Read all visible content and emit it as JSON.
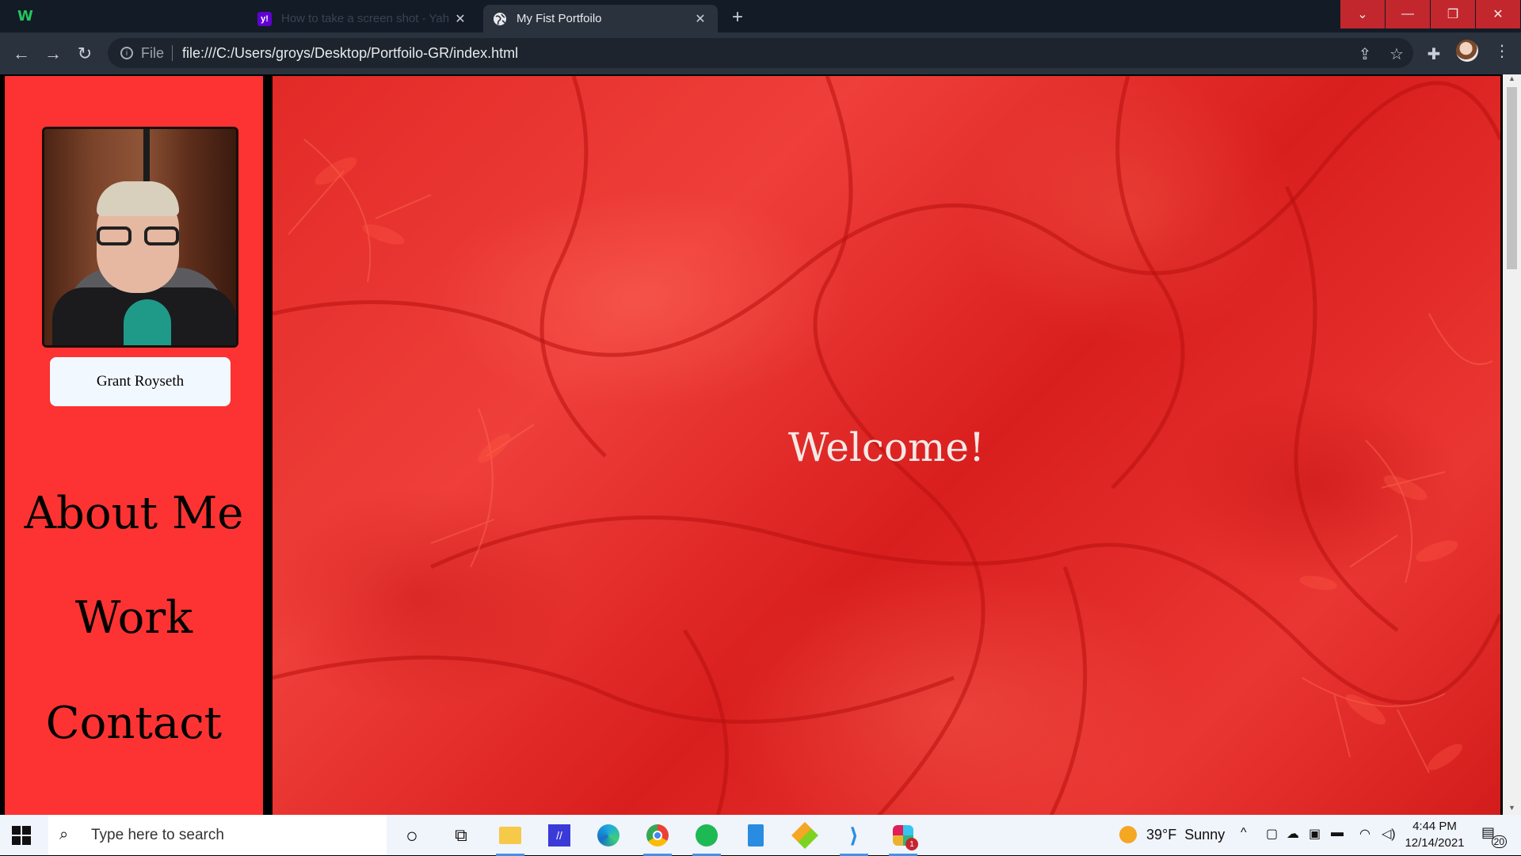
{
  "browser": {
    "tabs": [
      {
        "label": "How to take a screen shot - Yah",
        "favicon": "yahoo-icon",
        "active": false
      },
      {
        "label": "My Fist Portfoilo",
        "favicon": "globe-icon",
        "active": true
      }
    ],
    "favicon_yahoo_text": "y!",
    "address": {
      "scheme": "File",
      "url": "file:///C:/Users/groys/Desktop/Portfoilo-GR/index.html"
    }
  },
  "page": {
    "name": "Grant Royseth",
    "nav": [
      "About Me",
      "Work",
      "Contact"
    ],
    "welcome": "Welcome!"
  },
  "taskbar": {
    "search_placeholder": "Type here to search",
    "weather": {
      "temp": "39°F",
      "condition": "Sunny"
    },
    "clock": {
      "time": "4:44 PM",
      "date": "12/14/2021"
    },
    "notifications": "20",
    "slack_badge": "1",
    "pinned_apps": [
      "cortana",
      "task-view",
      "file-explorer",
      "pen-app",
      "edge",
      "chrome",
      "spotify",
      "notes-app",
      "git-app",
      "vscode",
      "slack"
    ]
  },
  "colors": {
    "sidebar": "#fc3332",
    "hero": "#e22a27",
    "tabbar": "#131b26",
    "toolbar": "#2a323d",
    "window_controls": "#c1272d"
  }
}
